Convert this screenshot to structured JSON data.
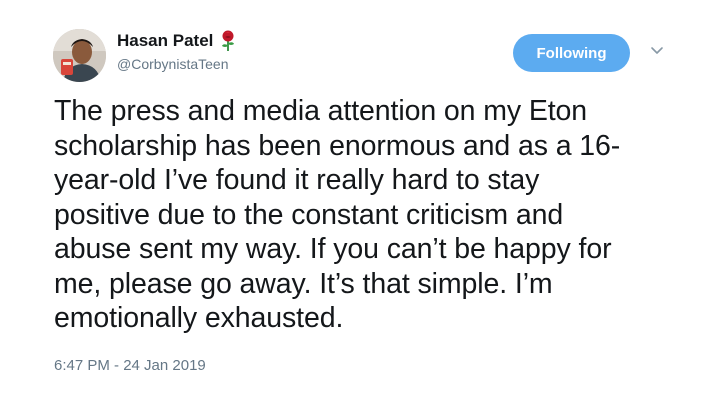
{
  "tweet": {
    "author": {
      "display_name": "Hasan Patel",
      "handle": "@CorbynistaTeen",
      "badge_icon": "rose-icon"
    },
    "follow_button_label": "Following",
    "text_lines": [
      "The press and media attention on my Eton",
      "scholarship has been enormous and as a 16-",
      "year-old I’ve found it really hard to stay",
      "positive due to the constant criticism and",
      "abuse sent my way. If you can’t be happy for",
      "me, please go away. It’s that simple. I’m",
      "emotionally exhausted."
    ],
    "timestamp": "6:47 PM - 24 Jan 2019",
    "colors": {
      "follow_button": "#5cabf0",
      "secondary_text": "#657786",
      "primary_text": "#14171a",
      "rose": "#c0182a"
    }
  }
}
